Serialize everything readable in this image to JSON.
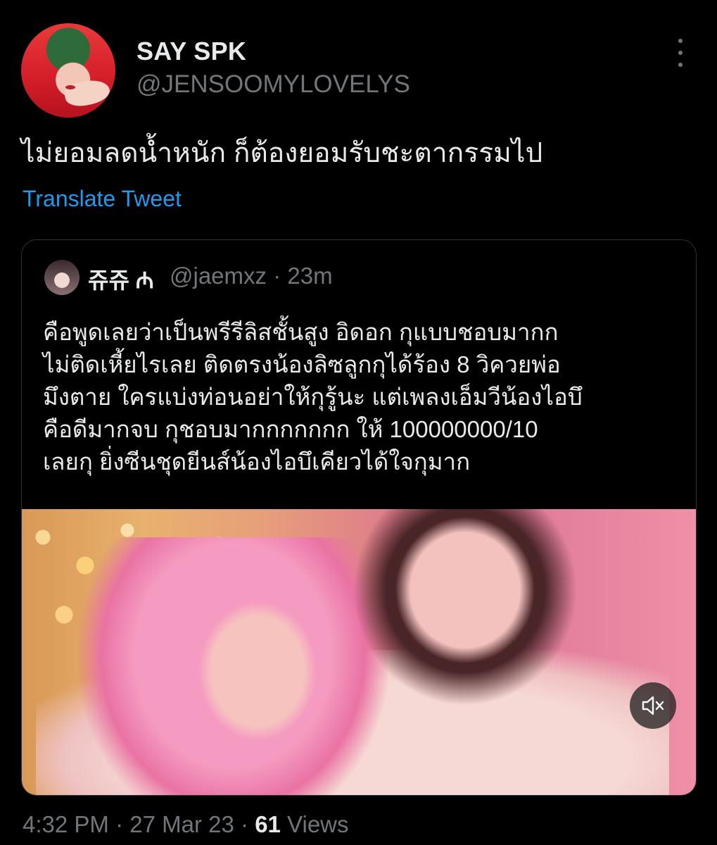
{
  "tweet": {
    "display_name": "SAY SPK",
    "handle": "@JENSOOMYLOVELYS",
    "text": "ไม่ยอมลดน้ำหนัก ก็ต้องยอมรับชะตากรรมไป",
    "translate_label": "Translate Tweet",
    "time": "4:32 PM",
    "date": "27 Mar 23",
    "views_count": "61",
    "views_label": "Views",
    "separator": "·"
  },
  "quoted_tweet": {
    "display_name": "쥬쥬 ₼",
    "handle": "@jaemxz",
    "age": "23m",
    "lines": [
      "คือพูดเลยว่าเป็นพรีรีลิสชั้นสูง อิดอก กุแบบชอบมากก",
      "ไม่ติดเหี้ยไรเลย ติดตรงน้องลิซลูกกุได้ร้อง 8 วิควยพ่อ",
      "มึงตาย ใครแบ่งท่อนอย่าให้กุรู้นะ แต่เพลงเอ็มวีน้องไอบึ",
      "คือดีมากจบ กุชอบมากกกกกกก ให้ 100000000/10",
      "เลยกุ ยิ่งซีนชุดยีนส์น้องไอบึเคียวได้ใจกุมาก"
    ]
  },
  "icons": {
    "more": "more-vertical-icon",
    "mute": "speaker-muted-icon"
  },
  "colors": {
    "background": "#000000",
    "text": "#e7e9ea",
    "secondary": "#71767b",
    "link": "#1d9bf0",
    "border": "#2f3336"
  }
}
